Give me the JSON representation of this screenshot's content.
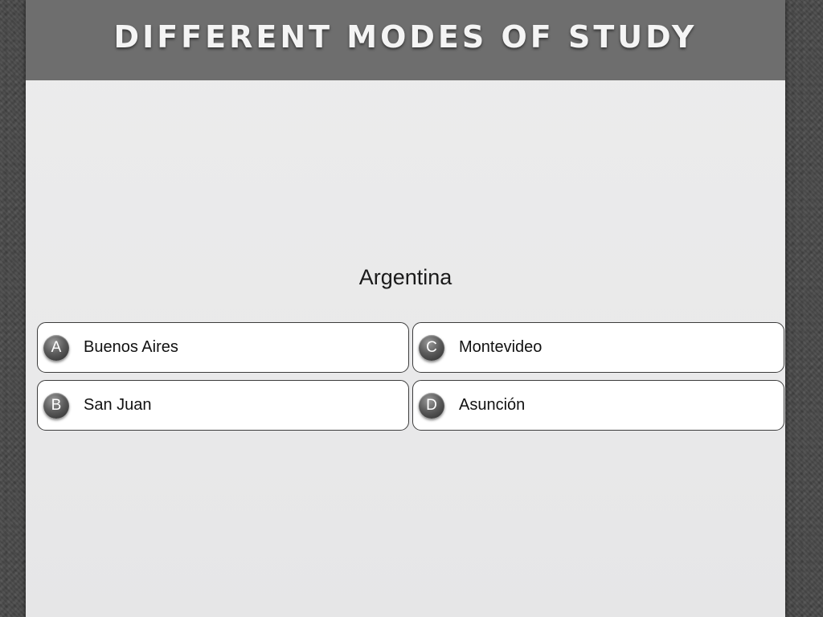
{
  "header": {
    "title": "DIFFERENT MODES OF STUDY"
  },
  "quiz": {
    "question": "Argentina",
    "answers": [
      {
        "letter": "A",
        "text": "Buenos Aires"
      },
      {
        "letter": "B",
        "text": "San Juan"
      },
      {
        "letter": "C",
        "text": "Montevideo"
      },
      {
        "letter": "D",
        "text": "Asunción"
      }
    ]
  },
  "colors": {
    "title_bar": "#6e6e6e",
    "slide_background": "#ececec",
    "page_background": "#4a4a4a",
    "answer_border": "#3c3c3c"
  }
}
